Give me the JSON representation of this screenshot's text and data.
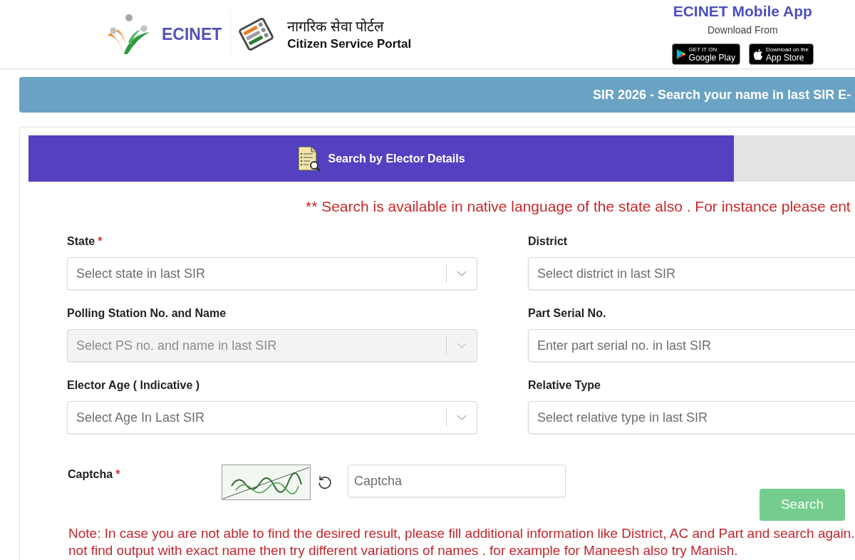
{
  "header": {
    "logo_text": "ECINET",
    "portal_title_local": "नागरिक सेवा पोर्टल",
    "portal_title": "Citizen Service Portal",
    "app_promo": {
      "title": "ECINET Mobile App",
      "subtitle": "Download From",
      "stores": [
        {
          "kind": "google_play",
          "caption": "GET IT ON",
          "name": "Google Play"
        },
        {
          "kind": "app_store",
          "caption": "Download on the",
          "name": "App Store"
        }
      ]
    }
  },
  "banner": {
    "text": "SIR 2026 - Search your name in last SIR E-"
  },
  "tabs": [
    {
      "label": "Search by Elector Details",
      "selected": true
    },
    {
      "selected": false
    }
  ],
  "notice": "** Search is available in native language of the state also . For instance please ent",
  "fields": [
    {
      "kind": "dropdown",
      "label": "State",
      "required_mark": "*",
      "placeholder": "Select state in last SIR",
      "disabled": false
    },
    {
      "kind": "text",
      "label": "District",
      "placeholder": "Select district in last SIR"
    },
    {
      "kind": "dropdown",
      "label": "Polling Station No. and Name",
      "placeholder": "Select PS no. and name in last SIR",
      "disabled": true
    },
    {
      "kind": "text",
      "label": "Part Serial No.",
      "placeholder": "Enter part serial no. in last SIR"
    },
    {
      "kind": "dropdown",
      "label": "Elector Age ( Indicative )",
      "placeholder": "Select Age In Last SIR",
      "disabled": false
    },
    {
      "kind": "text",
      "label": "Relative Type",
      "placeholder": "Select relative type in last SIR"
    }
  ],
  "captcha": {
    "label": "Captcha",
    "required_mark": "*",
    "placeholder": "Captcha"
  },
  "search_button": {
    "label": "Search",
    "disabled": true
  },
  "note_lines": [
    "Note: In case you are not able to find the desired result, please fill additional information like District, AC and Part and search again.",
    "not find output with exact name then try different variations of names . for example for Maneesh also try Manish."
  ]
}
